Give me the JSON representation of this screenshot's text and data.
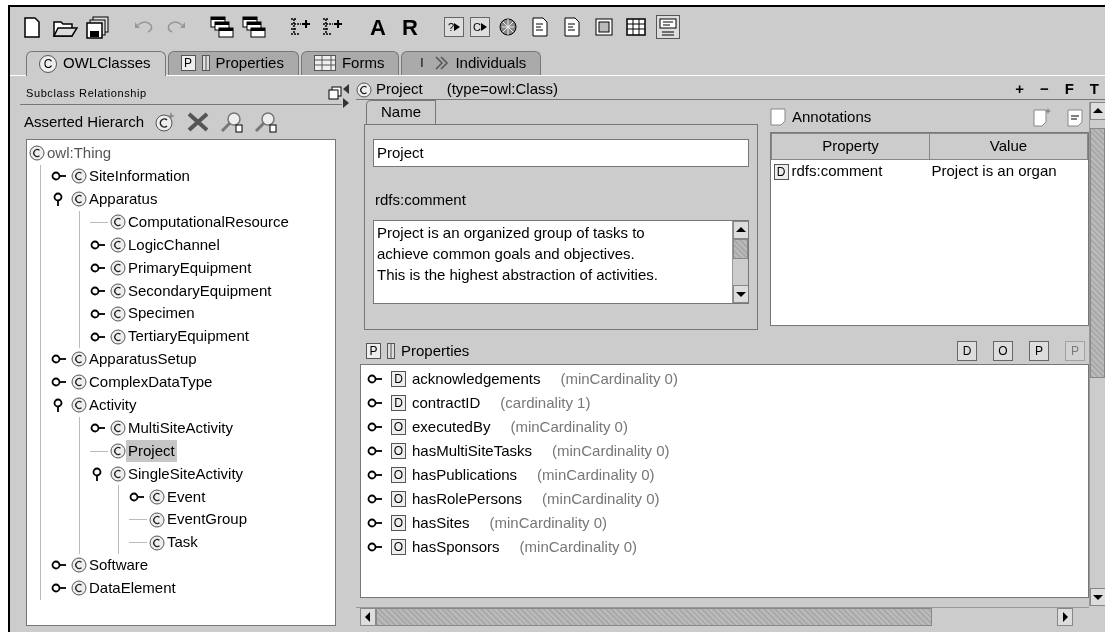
{
  "toolbar": [
    {
      "kind": "new",
      "disabled": false
    },
    {
      "kind": "open",
      "disabled": false
    },
    {
      "kind": "save",
      "disabled": false
    },
    {
      "kind": "undo",
      "disabled": true
    },
    {
      "kind": "redo",
      "disabled": true
    },
    {
      "kind": "stack",
      "disabled": false
    },
    {
      "kind": "stack",
      "disabled": false
    },
    {
      "kind": "lines",
      "disabled": false
    },
    {
      "kind": "lines",
      "disabled": false
    },
    {
      "kind": "text",
      "label": "A",
      "disabled": false
    },
    {
      "kind": "text",
      "label": "R",
      "disabled": false
    },
    {
      "kind": "boxed",
      "label": "?",
      "disabled": false
    },
    {
      "kind": "boxed",
      "label": "C",
      "disabled": false
    },
    {
      "kind": "gem",
      "disabled": false
    },
    {
      "kind": "doc",
      "disabled": false
    },
    {
      "kind": "doc",
      "disabled": false
    },
    {
      "kind": "window",
      "disabled": false
    },
    {
      "kind": "table",
      "disabled": false
    },
    {
      "kind": "help",
      "disabled": false
    }
  ],
  "tabs": [
    {
      "label": "OWLClasses",
      "icon_text": "C",
      "selected": true
    },
    {
      "label": "Properties",
      "icon_text": "P",
      "selected": false
    },
    {
      "label": "Forms",
      "selected": false
    },
    {
      "label": "Individuals",
      "icon_text": "I",
      "selected": false
    }
  ],
  "class_panel": {
    "header": "Subclass Relationship",
    "title": "Asserted Hierarch",
    "tree": [
      {
        "label": "owl:Thing",
        "selected": false,
        "children": [
          {
            "label": "SiteInformation",
            "expanded": false,
            "selected": false
          },
          {
            "label": "Apparatus",
            "expanded": true,
            "selected": false,
            "children": [
              {
                "label": "ComputationalResource",
                "selected": false
              },
              {
                "label": "LogicChannel",
                "expanded": false,
                "selected": false
              },
              {
                "label": "PrimaryEquipment",
                "expanded": false,
                "selected": false
              },
              {
                "label": "SecondaryEquipment",
                "expanded": false,
                "selected": false
              },
              {
                "label": "Specimen",
                "expanded": false,
                "selected": false
              },
              {
                "label": "TertiaryEquipment",
                "expanded": false,
                "selected": false
              }
            ]
          },
          {
            "label": "ApparatusSetup",
            "expanded": false,
            "selected": false
          },
          {
            "label": "ComplexDataType",
            "expanded": false,
            "selected": false
          },
          {
            "label": "Activity",
            "expanded": true,
            "selected": false,
            "children": [
              {
                "label": "MultiSiteActivity",
                "expanded": false,
                "selected": false
              },
              {
                "label": "Project",
                "selected": true
              },
              {
                "label": "SingleSiteActivity",
                "expanded": true,
                "selected": false,
                "children": [
                  {
                    "label": "Event",
                    "expanded": false,
                    "selected": false
                  },
                  {
                    "label": "EventGroup",
                    "selected": false
                  },
                  {
                    "label": "Task",
                    "selected": false
                  }
                ]
              }
            ]
          },
          {
            "label": "Software",
            "expanded": false,
            "selected": false
          },
          {
            "label": "DataElement",
            "expanded": false,
            "selected": false
          }
        ]
      }
    ]
  },
  "class_header": {
    "title": "Project",
    "type_text": "(type=owl:Class)",
    "actions": [
      "+",
      "−",
      "F",
      "T"
    ]
  },
  "name_form": {
    "tab": "Name",
    "name_value": "Project",
    "comment_label": "rdfs:comment",
    "comment_lines": [
      "Project is an organized group of tasks to",
      "achieve common goals and objectives.",
      "This is the highest abstraction of activities."
    ]
  },
  "annotations": {
    "title": "Annotations",
    "columns": [
      "Property",
      "Value"
    ],
    "rows": [
      {
        "property": "rdfs:comment",
        "icon_text": "D",
        "value": "Project is an organ"
      }
    ]
  },
  "properties": {
    "title": "Properties",
    "icon_text": "P",
    "tools": [
      {
        "letter": "D",
        "disabled": false
      },
      {
        "letter": "O",
        "disabled": false
      },
      {
        "letter": "P",
        "disabled": false
      },
      {
        "letter": "P",
        "disabled": true
      }
    ],
    "rows": [
      {
        "letter": "D",
        "name": "acknowledgements",
        "restriction": "(minCardinality 0)"
      },
      {
        "letter": "D",
        "name": "contractID",
        "restriction": "(cardinality 1)"
      },
      {
        "letter": "O",
        "name": "executedBy",
        "restriction": "(minCardinality 0)"
      },
      {
        "letter": "O",
        "name": "hasMultiSiteTasks",
        "restriction": "(minCardinality 0)"
      },
      {
        "letter": "O",
        "name": "hasPublications",
        "restriction": "(minCardinality 0)"
      },
      {
        "letter": "O",
        "name": "hasRolePersons",
        "restriction": "(minCardinality 0)"
      },
      {
        "letter": "O",
        "name": "hasSites",
        "restriction": "(minCardinality 0)"
      },
      {
        "letter": "O",
        "name": "hasSponsors",
        "restriction": "(minCardinality 0)"
      }
    ]
  }
}
